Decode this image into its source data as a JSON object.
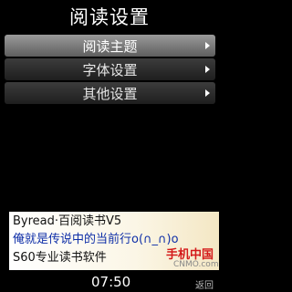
{
  "header": {
    "title": "阅读设置"
  },
  "menu": {
    "items": [
      {
        "label": "阅读主题"
      },
      {
        "label": "字体设置"
      },
      {
        "label": "其他设置"
      }
    ]
  },
  "banner": {
    "line1": "Byread·百阅读书V5",
    "line2": "俺就是传说中的当前行o(∩_∩)o",
    "line3": "S60专业读书软件"
  },
  "status": {
    "time": "07:50",
    "back": "返回"
  },
  "watermark": {
    "brand": "手机中国",
    "site": "CNMO.com"
  },
  "colors": {
    "selected_bg": "#7c7c7c",
    "item_bg": "#2c2c2c",
    "link_blue": "#0f2fa8",
    "brand_red": "#d41a1a"
  }
}
